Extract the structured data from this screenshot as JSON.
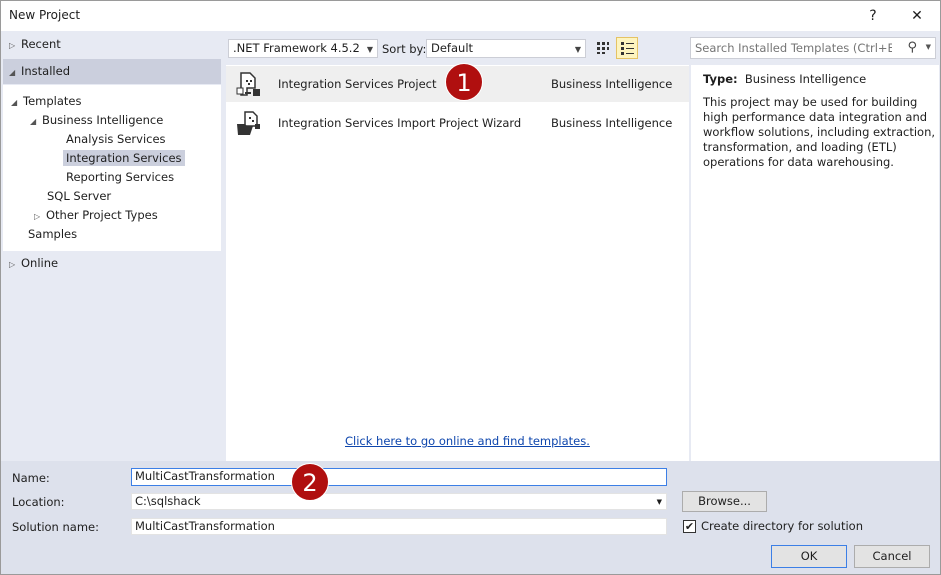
{
  "window": {
    "title": "New Project",
    "help": "?",
    "close": "✕"
  },
  "left": {
    "recent": "Recent",
    "installed": "Installed",
    "templates": "Templates",
    "bi": "Business Intelligence",
    "analysis": "Analysis Services",
    "integration": "Integration Services",
    "reporting": "Reporting Services",
    "sql": "SQL Server",
    "other": "Other Project Types",
    "samples": "Samples",
    "online": "Online"
  },
  "toolbar": {
    "framework": ".NET Framework 4.5.2",
    "sort_label": "Sort by:",
    "sort_value": "Default",
    "search_placeholder": "Search Installed Templates (Ctrl+E)"
  },
  "templates": [
    {
      "name": "Integration Services Project",
      "category": "Business Intelligence"
    },
    {
      "name": "Integration Services Import Project Wizard",
      "category": "Business Intelligence"
    }
  ],
  "online_link": "Click here to go online and find templates.",
  "details": {
    "type_label": "Type:",
    "type_value": "Business Intelligence",
    "description": "This project may be used for building high performance data integration and workflow solutions, including extraction, transformation, and loading (ETL) operations for data warehousing."
  },
  "form": {
    "name_label": "Name:",
    "name_value": "MultiCastTransformation",
    "location_label": "Location:",
    "location_value": "C:\\sqlshack",
    "solution_label": "Solution name:",
    "solution_value": "MultiCastTransformation",
    "browse": "Browse...",
    "create_dir": "Create directory for solution",
    "ok": "OK",
    "cancel": "Cancel"
  },
  "callouts": [
    "1",
    "2"
  ]
}
